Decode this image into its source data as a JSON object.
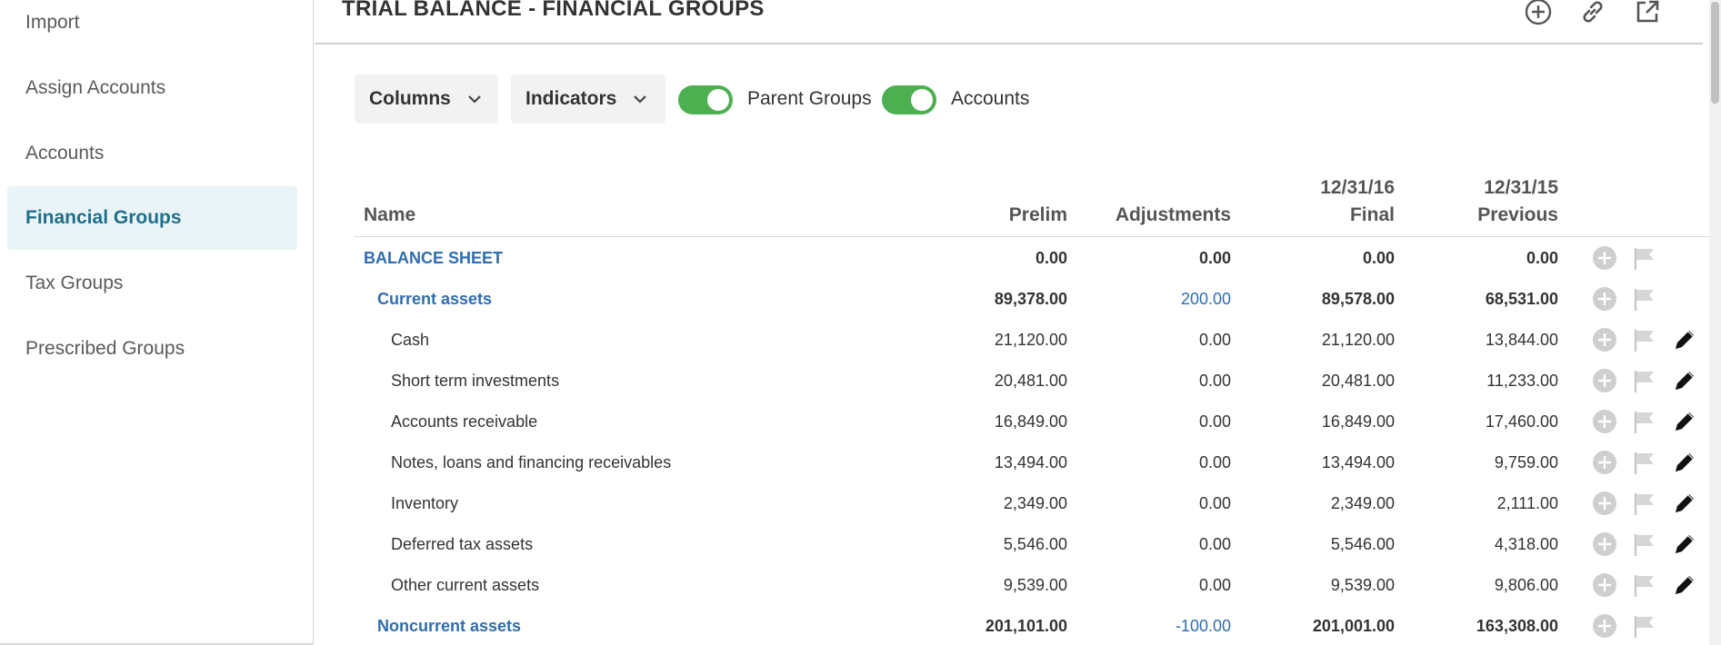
{
  "sidebar": {
    "items": [
      {
        "label": "Import",
        "active": false
      },
      {
        "label": "Assign Accounts",
        "active": false
      },
      {
        "label": "Accounts",
        "active": false
      },
      {
        "label": "Financial Groups",
        "active": true
      },
      {
        "label": "Tax Groups",
        "active": false
      },
      {
        "label": "Prescribed Groups",
        "active": false
      }
    ]
  },
  "header": {
    "title": "TRIAL BALANCE - FINANCIAL GROUPS",
    "icons": [
      "add-circle-icon",
      "link-icon",
      "open-external-icon"
    ]
  },
  "toolbar": {
    "columns_label": "Columns",
    "indicators_label": "Indicators",
    "parent_groups_label": "Parent Groups",
    "parent_groups_on": true,
    "accounts_label": "Accounts",
    "accounts_on": true
  },
  "table": {
    "headers": {
      "name": "Name",
      "prelim": "Prelim",
      "adjustments": "Adjustments",
      "final_date": "12/31/16",
      "final": "Final",
      "previous_date": "12/31/15",
      "previous": "Previous"
    },
    "rows": [
      {
        "name": "BALANCE SHEET",
        "level": 0,
        "prelim": "0.00",
        "adjustments": "0.00",
        "final": "0.00",
        "previous": "0.00",
        "editable": false
      },
      {
        "name": "Current assets",
        "level": 1,
        "prelim": "89,378.00",
        "adjustments": "200.00",
        "final": "89,578.00",
        "previous": "68,531.00",
        "editable": false
      },
      {
        "name": "Cash",
        "level": 2,
        "prelim": "21,120.00",
        "adjustments": "0.00",
        "final": "21,120.00",
        "previous": "13,844.00",
        "editable": true
      },
      {
        "name": "Short term investments",
        "level": 2,
        "prelim": "20,481.00",
        "adjustments": "0.00",
        "final": "20,481.00",
        "previous": "11,233.00",
        "editable": true
      },
      {
        "name": "Accounts receivable",
        "level": 2,
        "prelim": "16,849.00",
        "adjustments": "0.00",
        "final": "16,849.00",
        "previous": "17,460.00",
        "editable": true
      },
      {
        "name": "Notes, loans and financing receivables",
        "level": 2,
        "prelim": "13,494.00",
        "adjustments": "0.00",
        "final": "13,494.00",
        "previous": "9,759.00",
        "editable": true
      },
      {
        "name": "Inventory",
        "level": 2,
        "prelim": "2,349.00",
        "adjustments": "0.00",
        "final": "2,349.00",
        "previous": "2,111.00",
        "editable": true
      },
      {
        "name": "Deferred tax assets",
        "level": 2,
        "prelim": "5,546.00",
        "adjustments": "0.00",
        "final": "5,546.00",
        "previous": "4,318.00",
        "editable": true
      },
      {
        "name": "Other current assets",
        "level": 2,
        "prelim": "9,539.00",
        "adjustments": "0.00",
        "final": "9,539.00",
        "previous": "9,806.00",
        "editable": true
      },
      {
        "name": "Noncurrent assets",
        "level": 1,
        "prelim": "201,101.00",
        "adjustments": "-100.00",
        "final": "201,001.00",
        "previous": "163,308.00",
        "editable": false
      }
    ]
  },
  "colors": {
    "accent": "#1e6f8c",
    "link_blue": "#2f6db5",
    "toggle_on": "#4caf50",
    "active_nav_bg": "#eaf4f6"
  }
}
